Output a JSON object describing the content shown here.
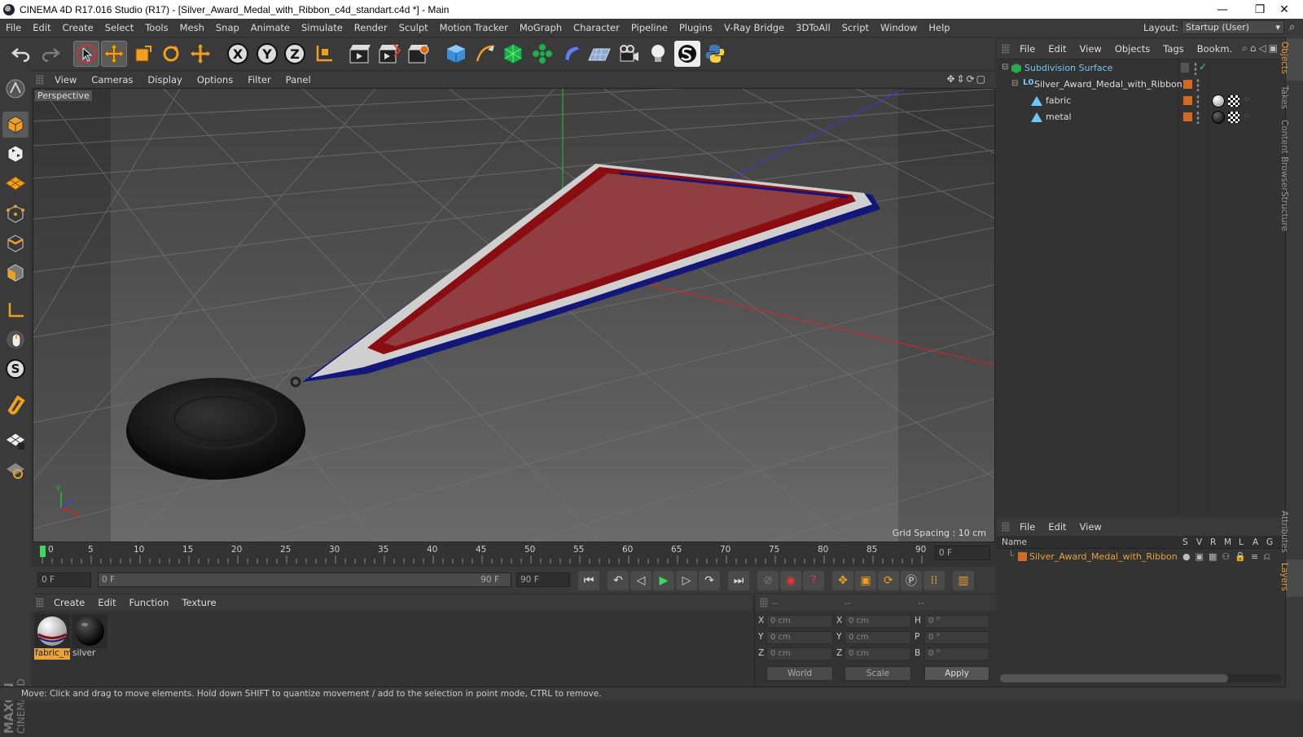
{
  "window": {
    "title": "CINEMA 4D R17.016 Studio (R17) - [Silver_Award_Medal_with_Ribbon_c4d_standart.c4d *] - Main",
    "minimize": "—",
    "restore": "❐",
    "close": "✕"
  },
  "menu": [
    "File",
    "Edit",
    "Create",
    "Select",
    "Tools",
    "Mesh",
    "Snap",
    "Animate",
    "Simulate",
    "Render",
    "Sculpt",
    "Motion Tracker",
    "MoGraph",
    "Character",
    "Pipeline",
    "Plugins",
    "V-Ray Bridge",
    "3DToAll",
    "Script",
    "Window",
    "Help"
  ],
  "layout": {
    "label": "Layout:",
    "value": "Startup (User)"
  },
  "toolbar": {
    "axis_x": "X",
    "axis_y": "Y",
    "axis_z": "Z"
  },
  "viewport": {
    "menu": [
      "View",
      "Cameras",
      "Display",
      "Options",
      "Filter",
      "Panel"
    ],
    "label": "Perspective",
    "grid_spacing": "Grid Spacing : 10 cm",
    "axis_y": "Y",
    "axis_x": "X"
  },
  "timeline": {
    "ticks": [
      "0",
      "5",
      "10",
      "15",
      "20",
      "25",
      "30",
      "35",
      "40",
      "45",
      "50",
      "55",
      "60",
      "65",
      "70",
      "75",
      "80",
      "85",
      "90"
    ],
    "current_frame": "0 F"
  },
  "transport": {
    "start": "0 F",
    "range_start": "0 F",
    "range_end": "90 F",
    "end": "90 F"
  },
  "materials": {
    "menu": [
      "Create",
      "Edit",
      "Function",
      "Texture"
    ],
    "items": [
      {
        "name": "fabric_m"
      },
      {
        "name": "silver"
      }
    ]
  },
  "coordinates": {
    "headers": [
      "--",
      "--",
      "--"
    ],
    "pos_labels": [
      "X",
      "Y",
      "Z"
    ],
    "size_labels": [
      "X",
      "Y",
      "Z"
    ],
    "rot_labels": [
      "H",
      "P",
      "B"
    ],
    "pos": [
      "0 cm",
      "0 cm",
      "0 cm"
    ],
    "size": [
      "0 cm",
      "0 cm",
      "0 cm"
    ],
    "rot": [
      "0 °",
      "0 °",
      "0 °"
    ],
    "mode": "World",
    "scale": "Scale",
    "apply": "Apply"
  },
  "object_manager": {
    "menu": [
      "File",
      "Edit",
      "View",
      "Objects",
      "Tags",
      "Bookm."
    ],
    "objects": [
      {
        "name": "Subdivision Surface",
        "indent": 0
      },
      {
        "name": "Silver_Award_Medal_with_Ribbon",
        "indent": 1
      },
      {
        "name": "fabric",
        "indent": 2
      },
      {
        "name": "metal",
        "indent": 2
      }
    ]
  },
  "layer_manager": {
    "menu": [
      "File",
      "Edit",
      "View"
    ],
    "columns": [
      "Name",
      "S",
      "V",
      "R",
      "M",
      "L",
      "A",
      "G"
    ],
    "layer_name": "Silver_Award_Medal_with_Ribbon"
  },
  "side_tabs": [
    "Objects",
    "Takes",
    "Content Browser",
    "Structure",
    "Attributes",
    "Layers"
  ],
  "status": "Move: Click and drag to move elements. Hold down SHIFT to quantize movement / add to the selection in point mode, CTRL to remove.",
  "maxon": {
    "brand": "MAXON",
    "product": "CINEMA 4D"
  },
  "colors": {
    "accent": "#e8a33b",
    "ribbon_red": "#8a0d12",
    "ribbon_blue": "#14177a",
    "ribbon_white": "#cfcfcf",
    "layer_swatch": "#d46a1f"
  }
}
